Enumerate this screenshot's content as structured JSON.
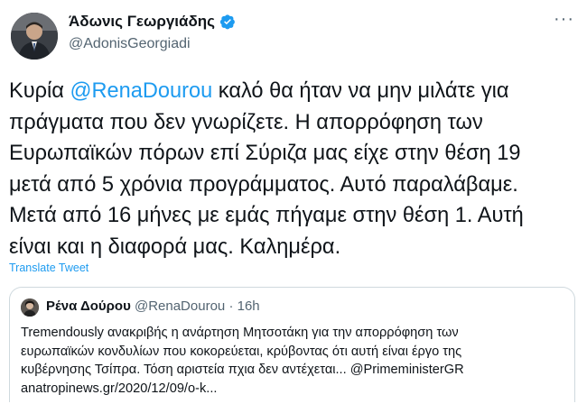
{
  "author": {
    "name": "Άδωνις Γεωργιάδης",
    "handle": "@AdonisGeorgiadi",
    "verified": true
  },
  "more_label": "···",
  "tweet": {
    "line1_pre": "Κυρία ",
    "line1_mention": "@RenaDourou",
    "line1_post": " καλό θα ήταν να μην μιλάτε για",
    "line2": "πράγματα που δεν γνωρίζετε. Η απορρόφηση των",
    "line3": "Ευρωπαϊκών πόρων επί Σύριζα μας είχε στην θέση 19",
    "line4": "μετά από 5 χρόνια προγράμματος. Αυτό παραλάβαμε.",
    "line5": "Μετά από 16 μήνες με εμάς πήγαμε στην θέση 1. Αυτή",
    "line6": "είναι και η διαφορά μας. Καλημέρα."
  },
  "translate_label": "Translate Tweet",
  "quote": {
    "name": "Ρένα Δούρου",
    "handle": "@RenaDourou",
    "dot": "·",
    "time": "16h",
    "line1": "Tremendously ανακριβής η ανάρτηση Μητσοτάκη για την απορρόφηση των",
    "line2": "ευρωπαϊκών κονδυλίων που κοκορεύεται, κρύβοντας ότι αυτή είναι έργο της",
    "line3_pre": "κυβέρνησης Τσίπρα. Τόση αριστεία πχια δεν αντέχεται... ",
    "line3_mention": "@PrimeministerGR",
    "line4": "anatropinews.gr/2020/12/09/o-k..."
  },
  "colors": {
    "accent": "#1d9bf0",
    "text": "#0f1419",
    "secondary": "#536471",
    "border": "#cfd9de"
  },
  "icons": {
    "verified": "verified-badge-icon",
    "more": "more-options-icon"
  }
}
